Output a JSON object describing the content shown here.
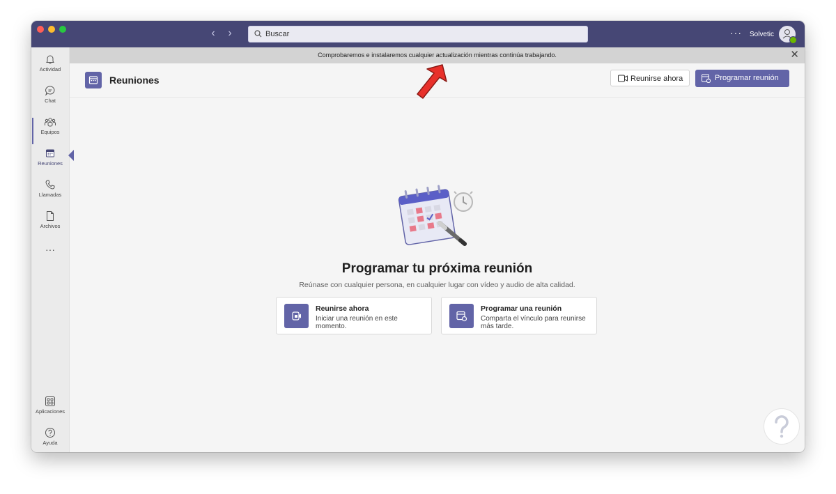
{
  "titlebar": {
    "search_placeholder": "Buscar",
    "user_name": "Solvetic",
    "more_glyph": "···",
    "back_glyph": "‹",
    "forward_glyph": "›"
  },
  "banner": {
    "message": "Comprobaremos e instalaremos cualquier actualización mientras continúa trabajando.",
    "close_glyph": "✕"
  },
  "rail": {
    "items": [
      {
        "label": "Actividad",
        "icon": "bell-icon"
      },
      {
        "label": "Chat",
        "icon": "chat-icon"
      },
      {
        "label": "Equipos",
        "icon": "teams-icon"
      },
      {
        "label": "Reuniones",
        "icon": "calendar-icon",
        "active": true
      },
      {
        "label": "Llamadas",
        "icon": "phone-icon"
      },
      {
        "label": "Archivos",
        "icon": "file-icon"
      }
    ],
    "more_glyph": "···",
    "bottom": [
      {
        "label": "Aplicaciones",
        "icon": "apps-icon"
      },
      {
        "label": "Ayuda",
        "icon": "help-icon"
      }
    ]
  },
  "header": {
    "title": "Reuniones",
    "meet_now_label": "Reunirse ahora",
    "schedule_label": "Programar reunión"
  },
  "main": {
    "title": "Programar tu próxima reunión",
    "subtitle": "Reúnase con cualquier persona, en cualquier lugar con vídeo y audio de alta calidad.",
    "cards": [
      {
        "title": "Reunirse ahora",
        "desc": "Iniciar una reunión en este momento."
      },
      {
        "title": "Programar una reunión",
        "desc": "Comparta el vínculo para reunirse más tarde."
      }
    ]
  },
  "colors": {
    "titlebar": "#464775",
    "accent": "#6264a7",
    "banner": "#d3d3d3",
    "annotation_arrow": "#e8302a"
  }
}
